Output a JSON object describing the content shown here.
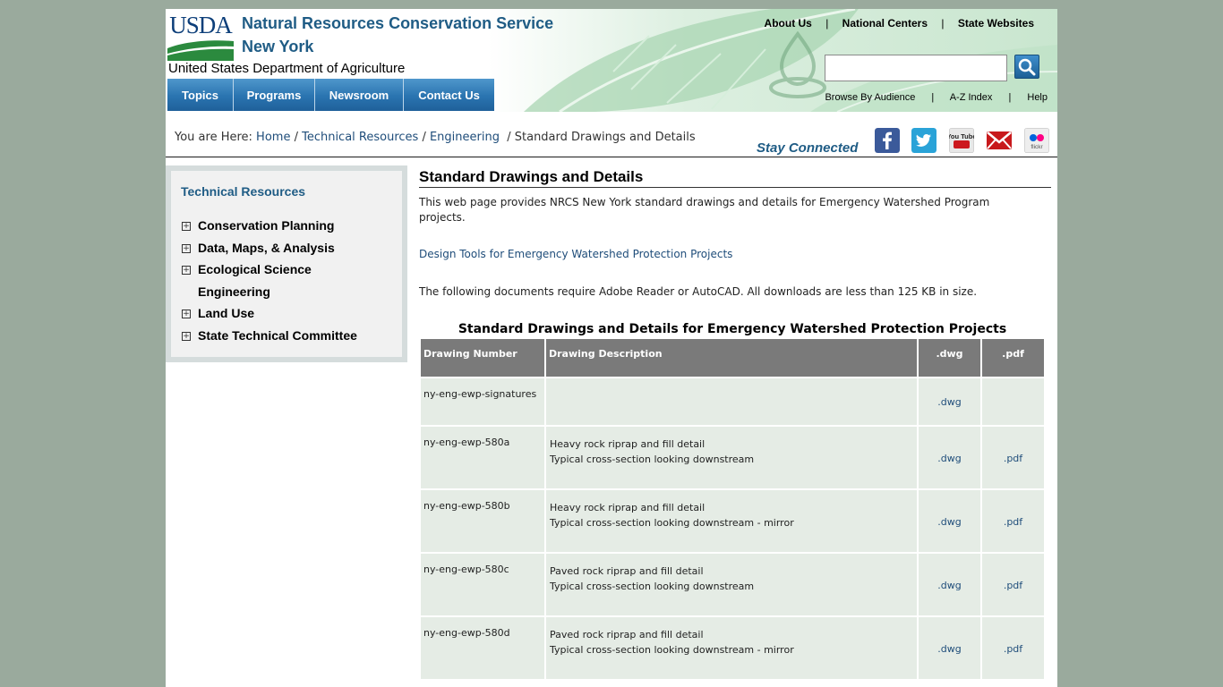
{
  "header": {
    "logo_text": "USDA",
    "agency": "Natural Resources Conservation Service",
    "state": "New York",
    "department": "United States Department of Agriculture",
    "top_links": [
      "About Us",
      "National Centers",
      "State Websites"
    ],
    "top_links_separator": "|",
    "search": {
      "value": "",
      "placeholder": ""
    },
    "search_icon": "magnifier-icon",
    "sub_links": [
      "Browse By Audience",
      "A-Z Index",
      "Help"
    ],
    "nav_tabs": [
      "Topics",
      "Programs",
      "Newsroom",
      "Contact Us"
    ]
  },
  "breadcrumb": {
    "prefix": "You are Here:",
    "items": [
      "Home",
      "Technical Resources",
      "Engineering"
    ],
    "current": "Standard Drawings and Details"
  },
  "social": {
    "label": "Stay Connected",
    "icons": [
      "facebook-icon",
      "twitter-icon",
      "youtube-icon",
      "email-icon",
      "flickr-icon"
    ],
    "youtube_text": "You Tube",
    "flickr_text": "flickr"
  },
  "sidebar": {
    "title": "Technical Resources",
    "items": [
      {
        "label": "Conservation Planning",
        "expandable": true
      },
      {
        "label": "Data, Maps, & Analysis",
        "expandable": true
      },
      {
        "label": "Ecological Science",
        "expandable": true
      },
      {
        "label": "Engineering",
        "expandable": false
      },
      {
        "label": "Land Use",
        "expandable": true
      },
      {
        "label": "State Technical Committee",
        "expandable": true
      }
    ]
  },
  "content": {
    "title": "Standard Drawings and Details",
    "intro": "This web page provides NRCS New York standard drawings and details for Emergency Watershed Program projects.",
    "design_link": "Design Tools for Emergency Watershed Protection Projects",
    "requirements": "The following documents require Adobe Reader or AutoCAD. All downloads are less than 125 KB in size.",
    "table": {
      "caption": "Standard Drawings and Details for Emergency Watershed Protection Projects",
      "headers": [
        "Drawing Number",
        "Drawing Description",
        ".dwg",
        ".pdf"
      ],
      "rows": [
        {
          "number": "ny-eng-ewp-signatures",
          "desc1": "",
          "desc2": "",
          "dwg": ".dwg",
          "pdf": ""
        },
        {
          "number": "ny-eng-ewp-580a",
          "desc1": "Heavy rock riprap and fill detail",
          "desc2": "Typical cross-section looking downstream",
          "dwg": ".dwg",
          "pdf": ".pdf"
        },
        {
          "number": "ny-eng-ewp-580b",
          "desc1": "Heavy rock riprap and fill detail",
          "desc2": "Typical cross-section looking downstream - mirror",
          "dwg": ".dwg",
          "pdf": ".pdf"
        },
        {
          "number": "ny-eng-ewp-580c",
          "desc1": "Paved rock riprap and fill detail",
          "desc2": "Typical cross-section looking downstream",
          "dwg": ".dwg",
          "pdf": ".pdf"
        },
        {
          "number": "ny-eng-ewp-580d",
          "desc1": "Paved rock riprap and fill detail",
          "desc2": "Typical cross-section looking downstream - mirror",
          "dwg": ".dwg",
          "pdf": ".pdf"
        }
      ]
    }
  },
  "colors": {
    "page_bg": "#9aaa9d",
    "brand_blue": "#1f5c85",
    "nav_tab": "#2a74b0",
    "table_header": "#7a7a7a",
    "table_cell": "#e5ece5",
    "link": "#1f4d7a"
  }
}
